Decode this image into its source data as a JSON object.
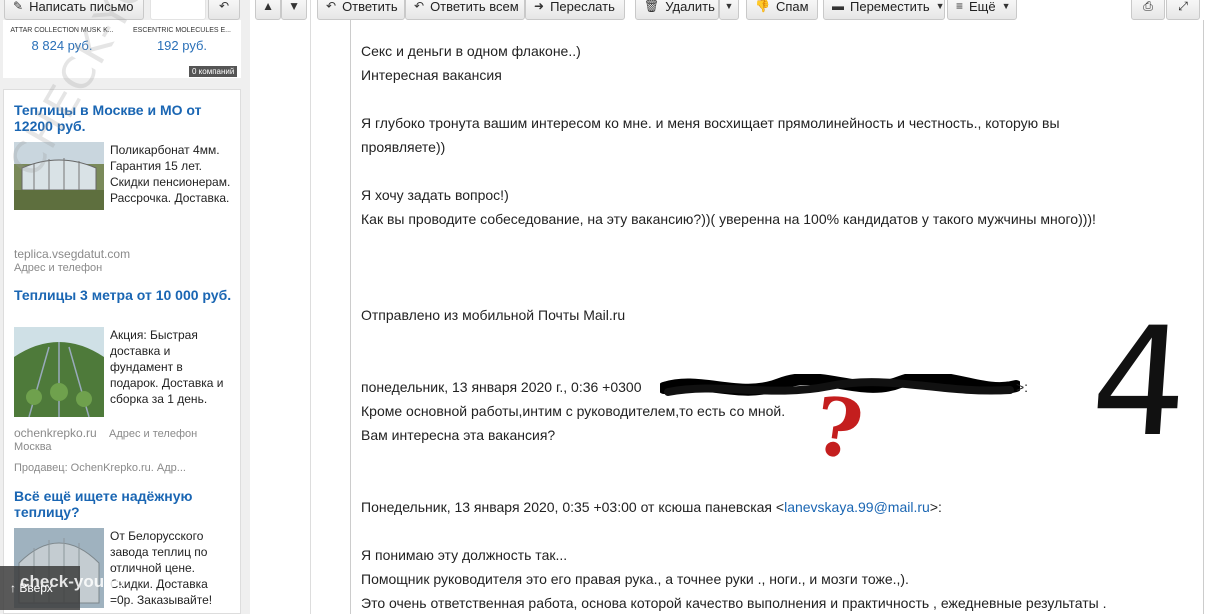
{
  "toolbar": {
    "compose": "Написать письмо",
    "reply": "Ответить",
    "reply_all": "Ответить всем",
    "forward": "Переслать",
    "delete": "Удалить",
    "spam": "Спам",
    "move": "Переместить",
    "more": "Ещё"
  },
  "sidebar": {
    "products": [
      {
        "name": "ATTAR COLLECTION MUSK K...",
        "price": "8 824 руб."
      },
      {
        "name": "ESCENTRIC MOLECULES E...",
        "price": "192 руб."
      }
    ],
    "companies_badge": "0 компаний",
    "ads": [
      {
        "title": "Теплицы в Москве и МО от 12200 руб.",
        "text": "Поликарбонат 4мм. Гарантия 15 лет. Скидки пенсионерам. Рассрочка. Доставка.",
        "domain": "teplica.vsegdatut.com",
        "extra": "Адрес и телефон"
      },
      {
        "title": "Теплицы 3 метра от 10 000 руб.",
        "text": "Акция: Быстрая доставка и фундамент в подарок. Доставка и сборка за 1 день.",
        "domain": "ochenkrepko.ru",
        "extra": "Адрес и телефон",
        "city": "Москва",
        "seller": "Продавец: OchenKrepko.ru. Адр..."
      },
      {
        "title": "Всё ещё ищете надёжную теплицу?",
        "text": "От Белорусского завода теплиц по отличной цене. Скидки. Доставка =0р. Заказывайте!"
      }
    ],
    "scroll_up": "Вверх"
  },
  "message": {
    "lines": [
      "Секс и деньги в одном флаконе..)",
      "Интересная вакансия",
      "Я глубоко тронута вашим интересом ко мне. и меня восхищает прямолинейность и честность., которую вы",
      "проявляете))",
      "Я хочу задать вопрос!)",
      "Как вы проводите собеседование, на эту вакансию?))( уверенна на 100% кандидатов у такого мужчины много)))!",
      "Отправлено из мобильной Почты Mail.ru",
      "понедельник, 13 января 2020 г., 0:36 +0300",
      "Кроме основной работы,интим с руководителем,то есть со мной.",
      "Вам интересна эта вакансия?",
      "Понедельник, 13 января 2020, 0:35 +03:00 от ксюша паневская <",
      "lanevskaya.99@mail.ru",
      ">:",
      "Я понимаю эту должность так...",
      "Помощник руководителя это его правая рука., а точнее руки ., ноги., и мозги тоже.,).",
      "Это очень ответственная работа, основа которой качество выполнения и практичность  , ежедневные результаты ."
    ],
    "redacted_suffix": ">:"
  },
  "watermark": "CHECK-YOU.ME",
  "watermark_small": "check-you.to",
  "annotation": {
    "question_mark": "?",
    "number": "4"
  }
}
